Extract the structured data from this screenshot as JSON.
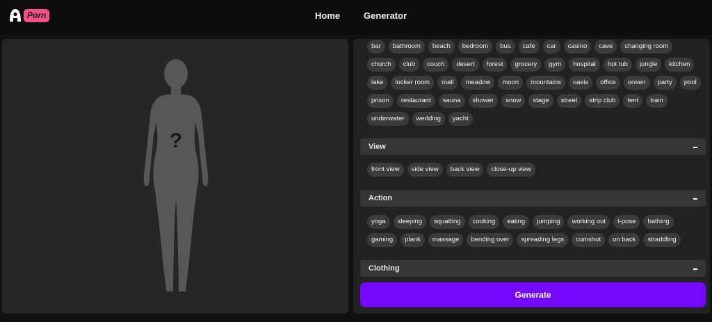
{
  "header": {
    "logo_text": "Porn",
    "nav": [
      "Home",
      "Generator"
    ]
  },
  "preview": {
    "placeholder_symbol": "?"
  },
  "place_tags": [
    "bar",
    "bathroom",
    "beach",
    "bedroom",
    "bus",
    "cafe",
    "car",
    "casino",
    "cave",
    "changing room",
    "church",
    "club",
    "couch",
    "desert",
    "forest",
    "grocery",
    "gym",
    "hospital",
    "hot tub",
    "jungle",
    "kitchen",
    "lake",
    "locker room",
    "mall",
    "meadow",
    "moon",
    "mountains",
    "oasis",
    "office",
    "onsen",
    "party",
    "pool",
    "prison",
    "restaurant",
    "sauna",
    "shower",
    "snow",
    "stage",
    "street",
    "strip club",
    "tent",
    "train",
    "underwater",
    "wedding",
    "yacht"
  ],
  "sections": {
    "view": {
      "title": "View",
      "toggle": "–",
      "tags": [
        "front view",
        "side view",
        "back view",
        "close-up view"
      ]
    },
    "action": {
      "title": "Action",
      "toggle": "–",
      "tags": [
        "yoga",
        "sleeping",
        "squatting",
        "cooking",
        "eating",
        "jumping",
        "working out",
        "t-pose",
        "bathing",
        "gaming",
        "plank",
        "massage",
        "bending over",
        "spreading legs",
        "cumshot",
        "on back",
        "straddling"
      ]
    },
    "clothing": {
      "title": "Clothing",
      "toggle": "–"
    }
  },
  "generate_label": "Generate",
  "colors": {
    "accent": "#7308fb",
    "brand": "#f5508a",
    "chip": "#3b3b3b"
  }
}
